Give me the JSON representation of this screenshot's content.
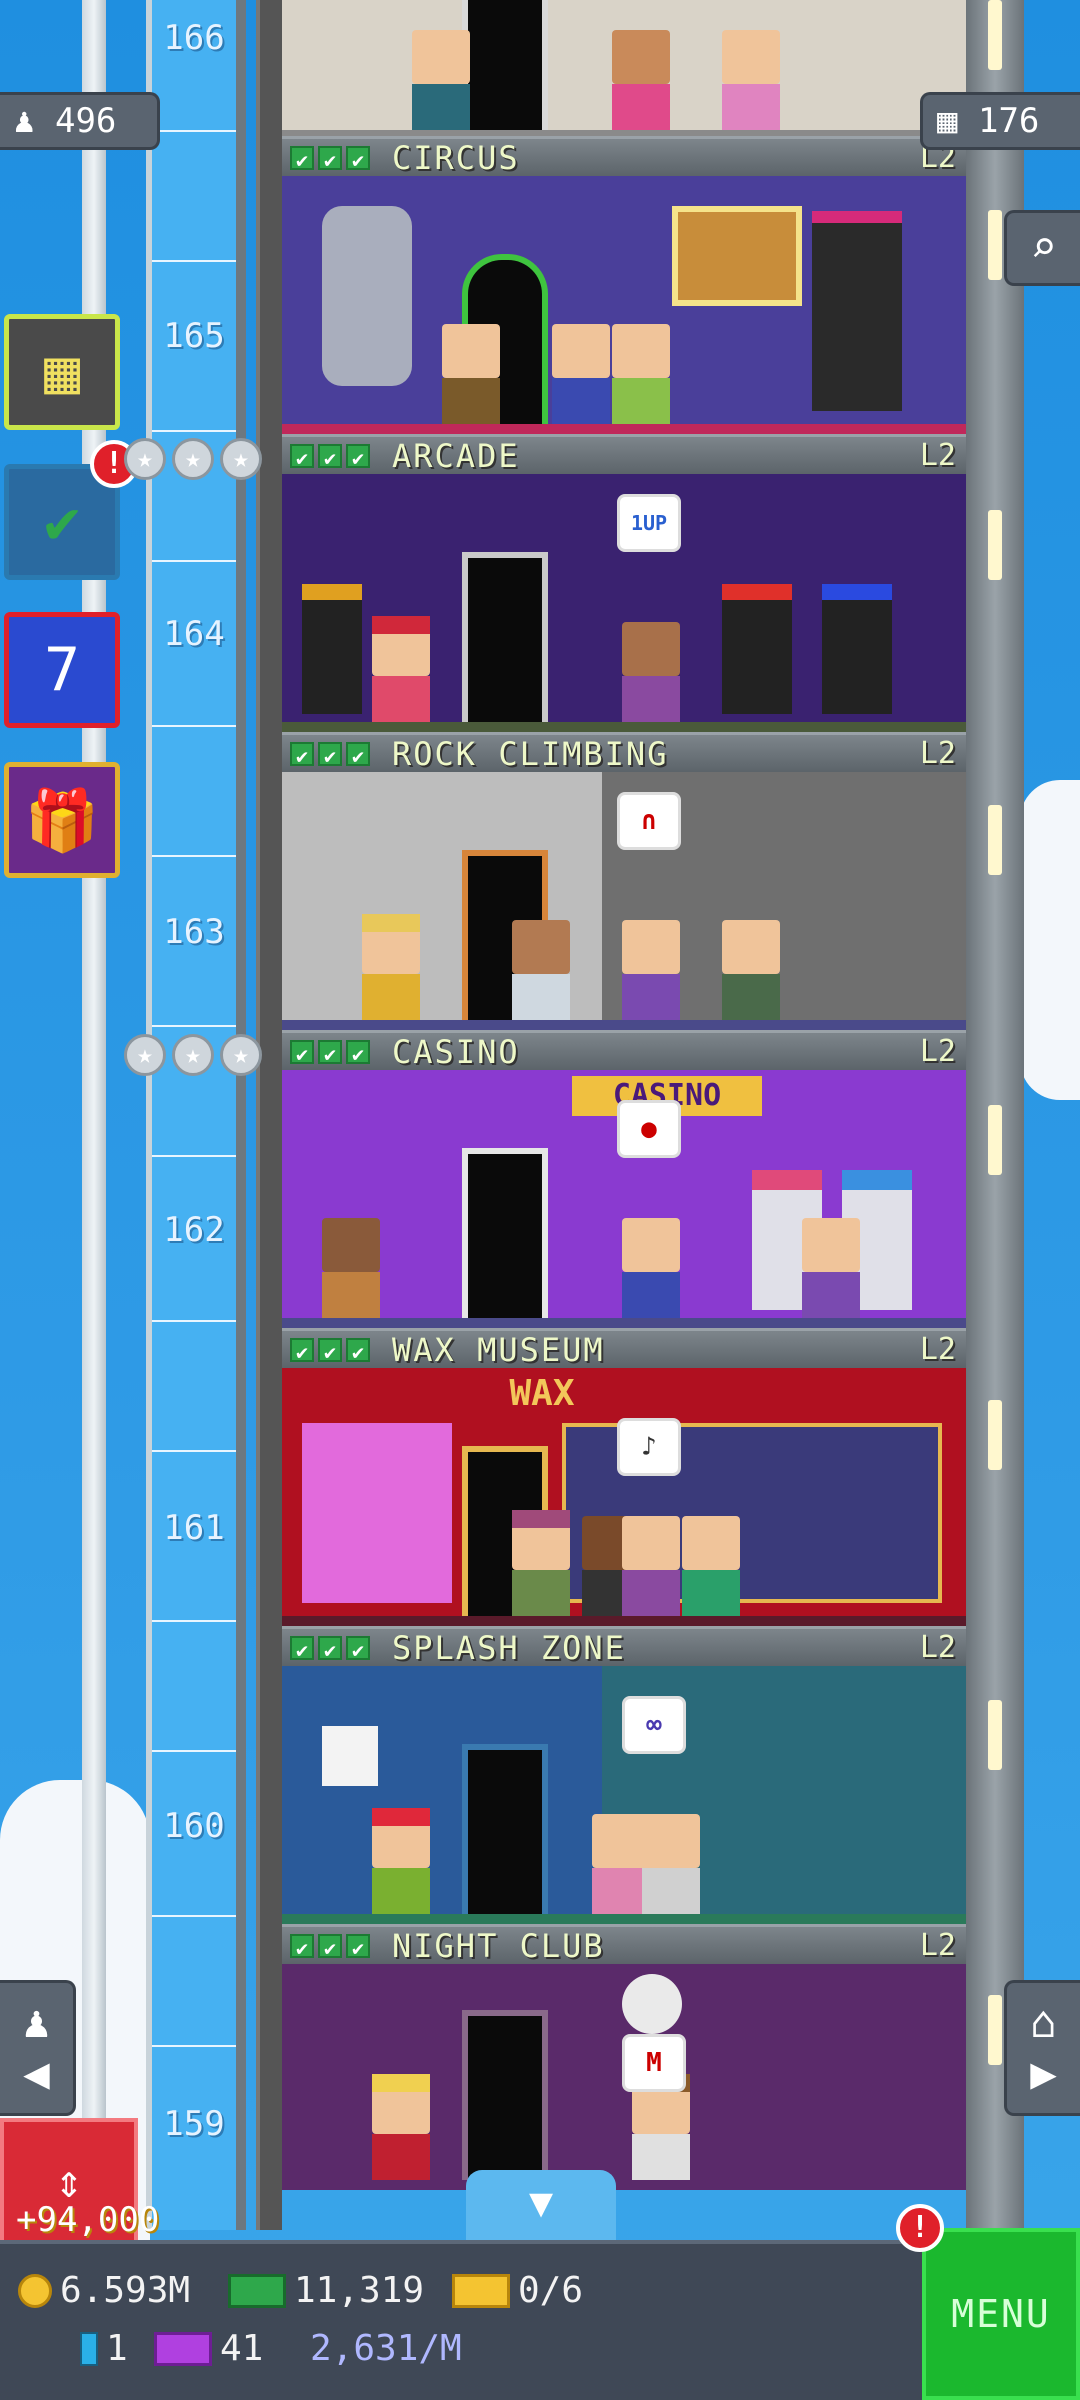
{
  "hud": {
    "population": "496",
    "floor_count": "176",
    "search_icon": "magnifier-icon",
    "coin_popup": "+94,000"
  },
  "side_buttons": [
    {
      "name": "build-floor",
      "icon": "building-icon"
    },
    {
      "name": "missions",
      "icon": "checklist-icon",
      "alert": "!"
    },
    {
      "name": "calendar",
      "icon": "calendar-icon",
      "day": "7"
    },
    {
      "name": "gift",
      "icon": "gift-icon"
    }
  ],
  "shaft_numbers": [
    "166",
    "165",
    "164",
    "163",
    "162",
    "161",
    "160",
    "159"
  ],
  "floors": [
    {
      "name": "CIRCUS",
      "level": "L2"
    },
    {
      "name": "ARCADE",
      "level": "L2"
    },
    {
      "name": "ROCK CLIMBING",
      "level": "L2"
    },
    {
      "name": "CASINO",
      "level": "L2"
    },
    {
      "name": "WAX MUSEUM",
      "level": "L2"
    },
    {
      "name": "SPLASH ZONE",
      "level": "L2"
    },
    {
      "name": "NIGHT CLUB",
      "level": "L2"
    }
  ],
  "room_signs": {
    "casino": "CASINO",
    "wax": "WAX",
    "arcade_bubble": "1UP"
  },
  "check_mark": "✔",
  "bottom": {
    "coins": "6.593M",
    "bux": "11,319",
    "tickets": "0/6",
    "vip": "1",
    "legendary": "41",
    "income_rate": "2,631/M",
    "menu_label": "MENU",
    "menu_alert": "!"
  },
  "colors": {
    "sky": "#2f9be6",
    "menu_green": "#1bb82e",
    "alert_red": "#e0202a"
  }
}
